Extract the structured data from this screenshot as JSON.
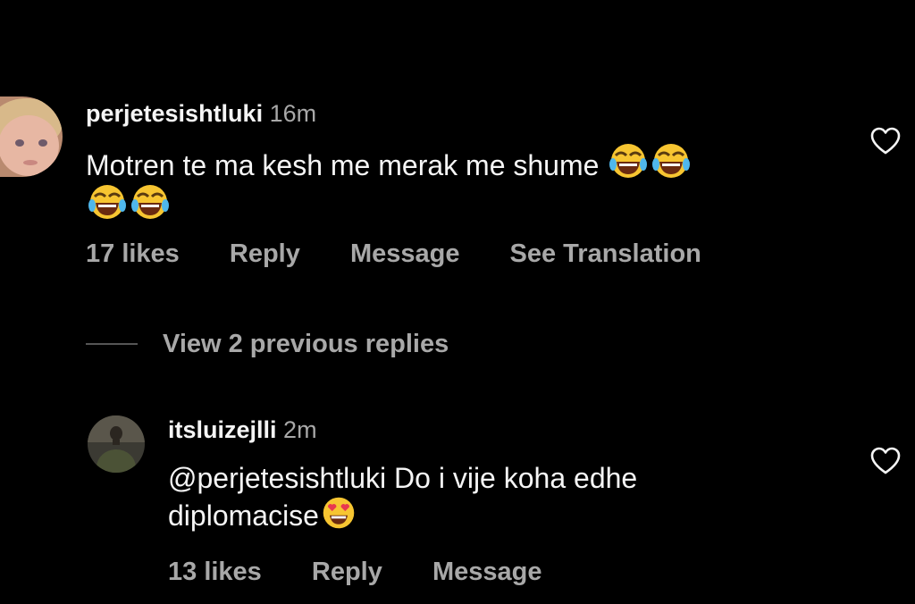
{
  "comments": [
    {
      "username": "perjetesishtluki",
      "time": "16m",
      "text_line1": "Motren te ma kesh me merak me shume",
      "emoji": "face-with-tears-of-joy",
      "likes": "17 likes",
      "reply": "Reply",
      "message": "Message",
      "translate": "See Translation"
    },
    {
      "username": "itsluizejlli",
      "time": "2m",
      "text_line1": "@perjetesishtluki Do i vije koha edhe",
      "text_line2": "diplomacise",
      "emoji": "smiling-face-with-heart-eyes",
      "likes": "13 likes",
      "reply": "Reply",
      "message": "Message"
    }
  ],
  "thread": {
    "view_previous": "View 2 previous replies"
  },
  "colors": {
    "background": "#000000",
    "text_primary": "#f5f5f5",
    "text_secondary": "#a8a8a8"
  }
}
